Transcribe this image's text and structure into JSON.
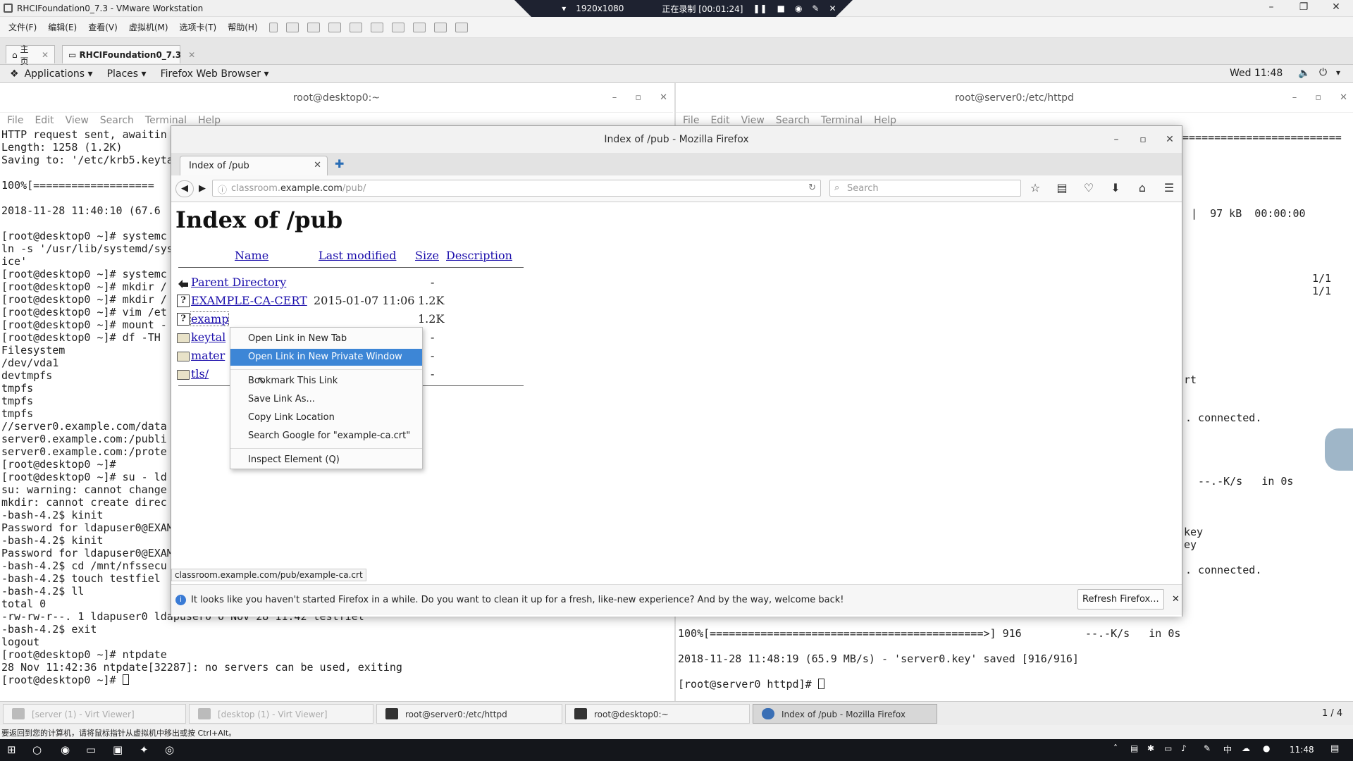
{
  "vmware": {
    "title": "RHCIFoundation0_7.3 - VMware Workstation",
    "recording": {
      "resolution": "1920x1080",
      "status": "正在录制 [00:01:24]"
    },
    "menu": [
      "文件(F)",
      "编辑(E)",
      "查看(V)",
      "虚拟机(M)",
      "选项卡(T)",
      "帮助(H)"
    ],
    "tabs": [
      {
        "label": "主页"
      },
      {
        "label": "RHCIFoundation0_7.3"
      }
    ],
    "status_hint": "要返回到您的计算机，请将鼠标指针从虚拟机中移出或按 Ctrl+Alt。"
  },
  "gnome": {
    "applications": "Applications",
    "places": "Places",
    "app_menu": "Firefox Web Browser",
    "clock": "Wed 11:48"
  },
  "terminals": {
    "left": {
      "title": "root@desktop0:~",
      "menu": [
        "File",
        "Edit",
        "View",
        "Search",
        "Terminal",
        "Help"
      ],
      "lines": [
        "HTTP request sent, awaitin",
        "Length: 1258 (1.2K)",
        "Saving to: '/etc/krb5.keyta",
        "",
        "100%[===================",
        "",
        "2018-11-28 11:40:10 (67.6",
        "",
        "[root@desktop0 ~]# systemc",
        "ln -s '/usr/lib/systemd/sys",
        "ice'",
        "[root@desktop0 ~]# systemc",
        "[root@desktop0 ~]# mkdir /",
        "[root@desktop0 ~]# mkdir /",
        "[root@desktop0 ~]# vim /et",
        "[root@desktop0 ~]# mount -",
        "[root@desktop0 ~]# df -TH",
        "Filesystem",
        "/dev/vda1",
        "devtmpfs",
        "tmpfs",
        "tmpfs",
        "tmpfs",
        "//server0.example.com/data",
        "server0.example.com:/publi",
        "server0.example.com:/prote",
        "[root@desktop0 ~]#",
        "[root@desktop0 ~]# su - ld",
        "su: warning: cannot change",
        "mkdir: cannot create direc",
        "-bash-4.2$ kinit",
        "Password for ldapuser0@EXAM",
        "-bash-4.2$ kinit",
        "Password for ldapuser0@EXAM",
        "-bash-4.2$ cd /mnt/nfssecu",
        "-bash-4.2$ touch testfiel",
        "-bash-4.2$ ll",
        "total 0",
        "-rw-rw-r--. 1 ldapuser0 ldapuser0 0 Nov 28 11:42 testfiel",
        "-bash-4.2$ exit",
        "logout",
        "[root@desktop0 ~]# ntpdate",
        "28 Nov 11:42:36 ntpdate[32287]: no servers can be used, exiting",
        "[root@desktop0 ~]# "
      ]
    },
    "right": {
      "title": "root@server0:/etc/httpd",
      "menu": [
        "File",
        "Edit",
        "View",
        "Search",
        "Terminal",
        "Help"
      ],
      "fragments": [
        "=========================",
        "|  97 kB  00:00:00",
        "1/1",
        "1/1",
        "rt",
        ". connected.",
        "--.-K/s   in 0s",
        "key",
        "ey",
        ". connected."
      ],
      "bottom_lines": [
        "100%[===========================================>] 916          --.-K/s   in 0s",
        "",
        "2018-11-28 11:48:19 (65.9 MB/s) - 'server0.key' saved [916/916]",
        "",
        "[root@server0 httpd]# "
      ]
    }
  },
  "firefox": {
    "window_title": "Index of /pub - Mozilla Firefox",
    "tab_label": "Index of /pub",
    "url": {
      "prefix": "classroom.",
      "host": "example.com",
      "path": "/pub/"
    },
    "search_placeholder": "Search",
    "page": {
      "heading": "Index of /pub",
      "columns": [
        "Name",
        "Last modified",
        "Size",
        "Description"
      ],
      "rows": [
        {
          "name": "Parent Directory",
          "modified": "",
          "size": "-",
          "icon": "back-icon"
        },
        {
          "name": "EXAMPLE-CA-CERT",
          "modified": "2015-01-07 11:06",
          "size": "1.2K",
          "icon": "file-icon"
        },
        {
          "name": "examp",
          "modified": "",
          "size": "1.2K",
          "icon": "file-icon"
        },
        {
          "name": "keytal",
          "modified": "",
          "size": "-",
          "icon": "folder-icon"
        },
        {
          "name": "mater",
          "modified": "",
          "size": "-",
          "icon": "folder-icon"
        },
        {
          "name": "tls/",
          "modified": "",
          "size": "-",
          "icon": "folder-icon"
        }
      ]
    },
    "status_url": "classroom.example.com/pub/example-ca.crt",
    "notification": {
      "message": "It looks like you haven't started Firefox in a while. Do you want to clean it up for a fresh, like-new experience? And by the way, welcome back!",
      "button": "Refresh Firefox..."
    },
    "context_menu": [
      "Open Link in New Tab",
      "Open Link in New Private Window",
      "Bookmark This Link",
      "Save Link As...",
      "Copy Link Location",
      "Search Google for \"example-ca.crt\"",
      "Inspect Element (Q)"
    ]
  },
  "gnome_taskbar": [
    {
      "label": "[server (1) - Virt Viewer]",
      "state": "dim"
    },
    {
      "label": "[desktop (1) - Virt Viewer]",
      "state": "dim"
    },
    {
      "label": "root@server0:/etc/httpd",
      "state": "normal"
    },
    {
      "label": "root@desktop0:~",
      "state": "normal"
    },
    {
      "label": "Index of /pub - Mozilla Firefox",
      "state": "active"
    }
  ],
  "workspace_indicator": "1 / 4",
  "windows_taskbar": {
    "clock": "11:48"
  }
}
